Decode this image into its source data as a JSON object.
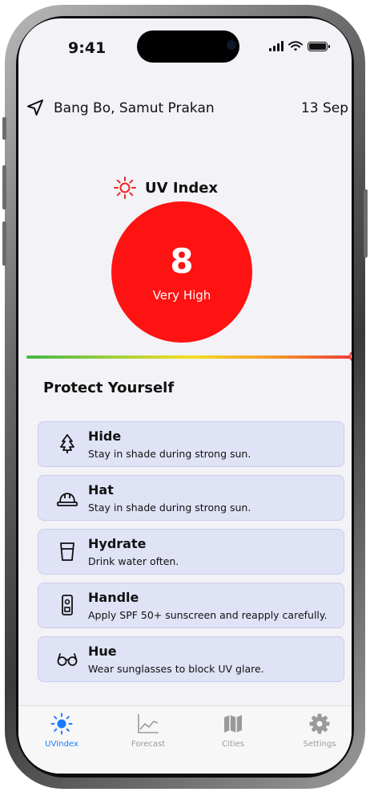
{
  "status_bar": {
    "time": "9:41"
  },
  "header": {
    "location": "Bang Bo, Samut Prakan",
    "date": "13 Sep"
  },
  "uv": {
    "title": "UV Index",
    "value": "8",
    "level": "Very High",
    "level_color": "#ff1212",
    "scale_fraction": 1.0
  },
  "protect": {
    "title": "Protect Yourself",
    "tips": [
      {
        "icon": "tree-icon",
        "title": "Hide",
        "description": "Stay in shade during strong sun."
      },
      {
        "icon": "hard-hat-icon",
        "title": "Hat",
        "description": "Stay in shade during strong sun."
      },
      {
        "icon": "glass-icon",
        "title": "Hydrate",
        "description": "Drink water often."
      },
      {
        "icon": "sunscreen-bottle-icon",
        "title": "Handle",
        "description": "Apply SPF 50+ sunscreen and reapply carefully."
      },
      {
        "icon": "sunglasses-icon",
        "title": "Hue",
        "description": "Wear sunglasses to block UV glare."
      }
    ]
  },
  "tabbar": {
    "active": "UVIndex",
    "accent": "#1b7bff",
    "items": [
      {
        "icon": "sun-icon",
        "label": "UVIndex"
      },
      {
        "icon": "chart-icon",
        "label": "Forecast"
      },
      {
        "icon": "map-icon",
        "label": "Cities"
      },
      {
        "icon": "gear-icon",
        "label": "Settings"
      }
    ]
  }
}
